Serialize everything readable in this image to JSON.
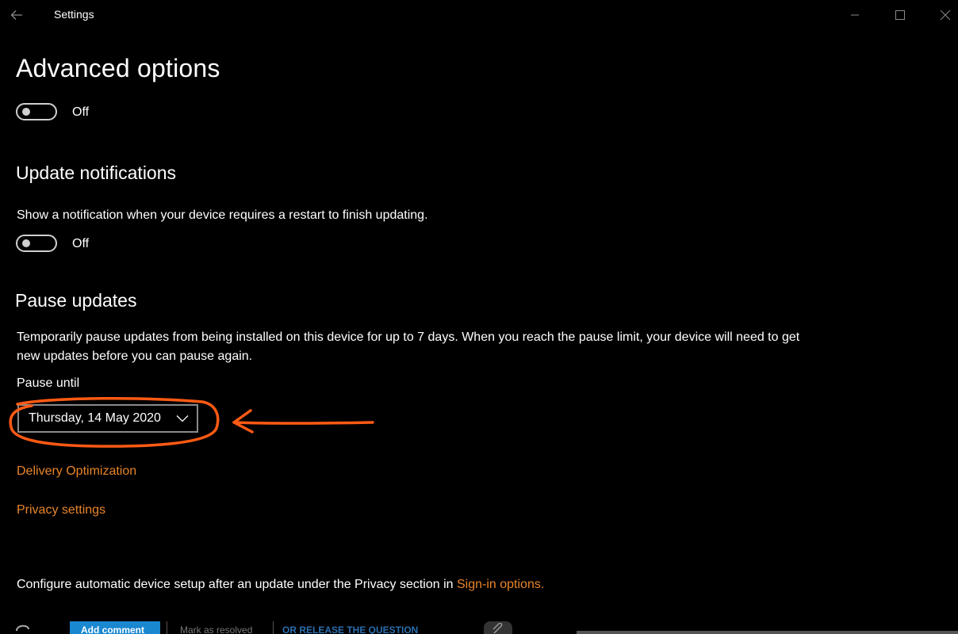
{
  "window": {
    "title": "Settings"
  },
  "page": {
    "title": "Advanced options"
  },
  "advanced": {
    "toggle_state": "Off"
  },
  "update_notifications": {
    "heading": "Update notifications",
    "description": "Show a notification when your device requires a restart to finish updating.",
    "toggle_state": "Off"
  },
  "pause_updates": {
    "heading": "Pause updates",
    "description": "Temporarily pause updates from being installed on this device for up to 7 days. When you reach the pause limit, your device will need to get new updates before you can pause again.",
    "pause_until_label": "Pause until",
    "selected_date": "Thursday, 14 May 2020"
  },
  "links": {
    "delivery_optimization": "Delivery Optimization",
    "privacy_settings": "Privacy settings"
  },
  "footer": {
    "text": "Configure automatic device setup after an update under the Privacy section in",
    "link": "Sign-in options."
  },
  "bottom_bar": {
    "add_comment": "Add comment",
    "mark_resolved": "Mark as resolved",
    "or_release": "OR RELEASE THE QUESTION"
  },
  "colors": {
    "background": "#000000",
    "link": "#e8842a",
    "annotation": "#ff5a14"
  }
}
